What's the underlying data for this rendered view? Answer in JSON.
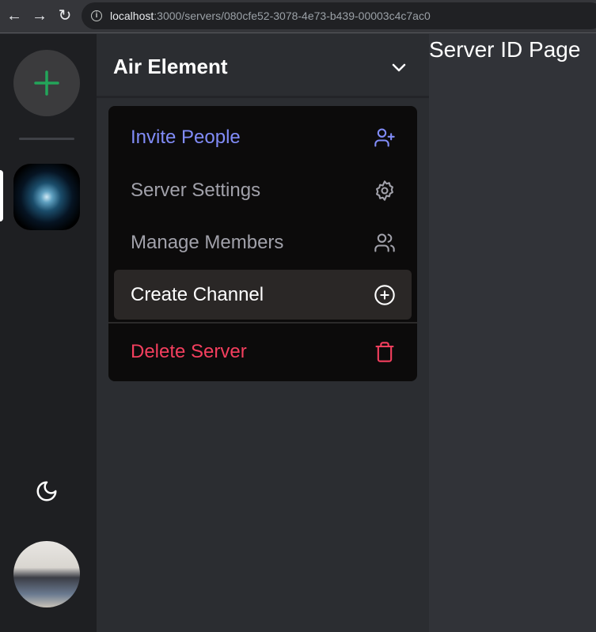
{
  "browser": {
    "url_host": "localhost",
    "url_rest": ":3000/servers/080cfe52-3078-4e73-b439-00003c4c7ac0"
  },
  "rail": {
    "add_icon": "plus-icon",
    "theme_icon": "moon-icon",
    "accent": "#23a55a"
  },
  "server": {
    "name": "Air Element"
  },
  "main": {
    "title": "Server ID Page"
  },
  "menu": {
    "items": [
      {
        "label": "Invite People",
        "icon": "user-plus-icon",
        "color": "#818cf8"
      },
      {
        "label": "Server Settings",
        "icon": "settings-icon",
        "color": "#a1a1aa"
      },
      {
        "label": "Manage Members",
        "icon": "users-icon",
        "color": "#a1a1aa"
      },
      {
        "label": "Create Channel",
        "icon": "plus-circle-icon",
        "color": "#ffffff"
      },
      {
        "label": "Delete Server",
        "icon": "trash-icon",
        "color": "#f43f5e"
      }
    ]
  }
}
